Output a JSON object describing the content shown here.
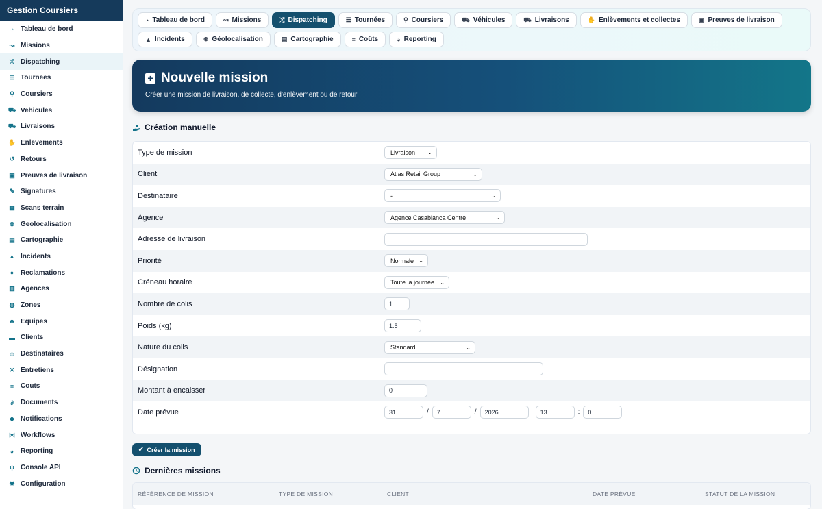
{
  "app": {
    "title": "Gestion Coursiers"
  },
  "sidebar": {
    "items": [
      {
        "label": "Tableau de bord",
        "icon": "gauge-icon"
      },
      {
        "label": "Missions",
        "icon": "route-icon"
      },
      {
        "label": "Dispatching",
        "icon": "shuffle-icon",
        "active": true
      },
      {
        "label": "Tournees",
        "icon": "signs-icon"
      },
      {
        "label": "Coursiers",
        "icon": "bicycle-icon"
      },
      {
        "label": "Vehicules",
        "icon": "truck-icon"
      },
      {
        "label": "Livraisons",
        "icon": "truck-fast-icon"
      },
      {
        "label": "Enlevements",
        "icon": "hand-package-icon"
      },
      {
        "label": "Retours",
        "icon": "return-icon"
      },
      {
        "label": "Preuves de livraison",
        "icon": "clipboard-check-icon"
      },
      {
        "label": "Signatures",
        "icon": "signature-icon"
      },
      {
        "label": "Scans terrain",
        "icon": "qrcode-icon"
      },
      {
        "label": "Geolocalisation",
        "icon": "satellite-icon"
      },
      {
        "label": "Cartographie",
        "icon": "map-icon"
      },
      {
        "label": "Incidents",
        "icon": "warning-icon"
      },
      {
        "label": "Reclamations",
        "icon": "comment-icon"
      },
      {
        "label": "Agences",
        "icon": "building-icon"
      },
      {
        "label": "Zones",
        "icon": "globe-icon"
      },
      {
        "label": "Equipes",
        "icon": "users-icon"
      },
      {
        "label": "Clients",
        "icon": "briefcase-icon"
      },
      {
        "label": "Destinataires",
        "icon": "user-tag-icon"
      },
      {
        "label": "Entretiens",
        "icon": "tools-icon"
      },
      {
        "label": "Couts",
        "icon": "coins-icon"
      },
      {
        "label": "Documents",
        "icon": "paperclip-icon"
      },
      {
        "label": "Notifications",
        "icon": "bell-icon"
      },
      {
        "label": "Workflows",
        "icon": "workflow-icon"
      },
      {
        "label": "Reporting",
        "icon": "pie-chart-icon"
      },
      {
        "label": "Console API",
        "icon": "plug-icon"
      },
      {
        "label": "Configuration",
        "icon": "gear-icon"
      }
    ]
  },
  "tabs": [
    {
      "label": "Tableau de bord",
      "icon": "gauge-icon"
    },
    {
      "label": "Missions",
      "icon": "route-icon"
    },
    {
      "label": "Dispatching",
      "icon": "shuffle-icon",
      "active": true
    },
    {
      "label": "Tournées",
      "icon": "signs-icon"
    },
    {
      "label": "Coursiers",
      "icon": "bicycle-icon"
    },
    {
      "label": "Véhicules",
      "icon": "truck-icon"
    },
    {
      "label": "Livraisons",
      "icon": "truck-fast-icon"
    },
    {
      "label": "Enlèvements et collectes",
      "icon": "hand-package-icon"
    },
    {
      "label": "Preuves de livraison",
      "icon": "clipboard-check-icon"
    },
    {
      "label": "Incidents",
      "icon": "warning-icon"
    },
    {
      "label": "Géolocalisation",
      "icon": "satellite-icon"
    },
    {
      "label": "Cartographie",
      "icon": "map-icon"
    },
    {
      "label": "Coûts",
      "icon": "coins-icon"
    },
    {
      "label": "Reporting",
      "icon": "pie-chart-icon"
    }
  ],
  "hero": {
    "title": "Nouvelle mission",
    "subtitle": "Créer une mission de livraison, de collecte, d'enlèvement ou de retour"
  },
  "form": {
    "section_title": "Création manuelle",
    "fields": {
      "type": {
        "label": "Type de mission",
        "value": "Livraison"
      },
      "client": {
        "label": "Client",
        "value": "Atlas Retail Group"
      },
      "destinataire": {
        "label": "Destinataire",
        "value": "-"
      },
      "agence": {
        "label": "Agence",
        "value": "Agence Casablanca Centre"
      },
      "adresse": {
        "label": "Adresse de livraison",
        "value": ""
      },
      "priorite": {
        "label": "Priorité",
        "value": "Normale"
      },
      "creneau": {
        "label": "Créneau horaire",
        "value": "Toute la journée"
      },
      "colis": {
        "label": "Nombre de colis",
        "value": "1"
      },
      "poids": {
        "label": "Poids (kg)",
        "value": "1.5"
      },
      "nature": {
        "label": "Nature du colis",
        "value": "Standard"
      },
      "designation": {
        "label": "Désignation",
        "value": ""
      },
      "montant": {
        "label": "Montant à encaisser",
        "value": "0"
      },
      "date": {
        "label": "Date prévue",
        "day": "31",
        "month": "7",
        "year": "2026",
        "hour": "13",
        "minute": "0",
        "sep_date": "/",
        "sep_time": ":"
      }
    },
    "submit_label": "Créer la mission"
  },
  "recent": {
    "title": "Dernières missions",
    "columns": [
      "RÉFÉRENCE DE MISSION",
      "TYPE DE MISSION",
      "CLIENT",
      "DATE PRÉVUE",
      "STATUT DE LA MISSION"
    ]
  }
}
